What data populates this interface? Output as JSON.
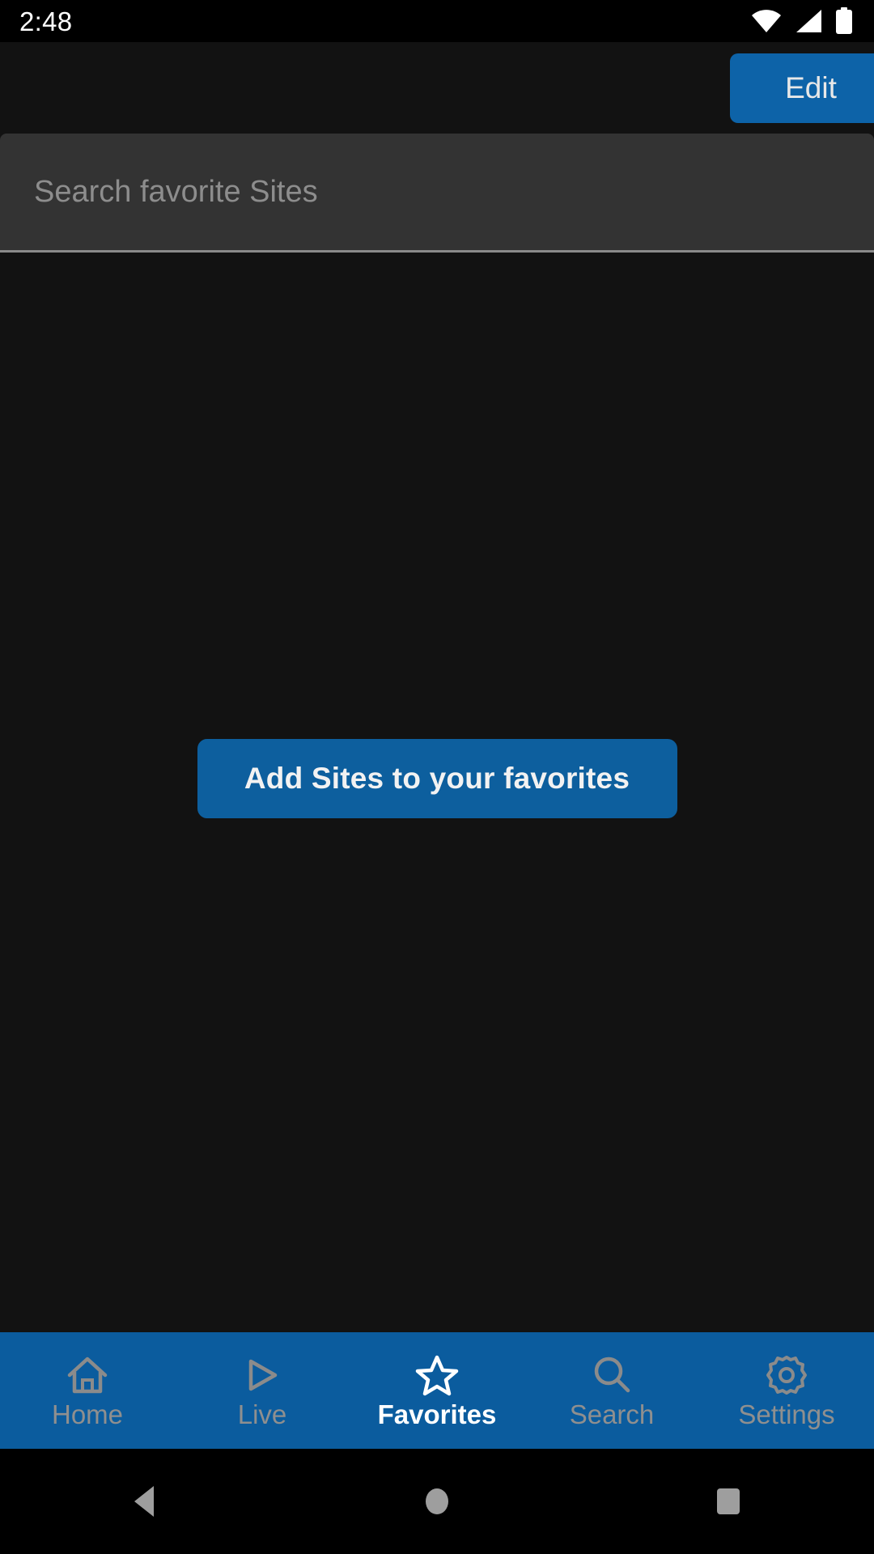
{
  "status_bar": {
    "clock": "2:48",
    "icons": [
      "wifi-icon",
      "cellular-signal-icon",
      "battery-icon"
    ]
  },
  "toolbar": {
    "edit_label": "Edit"
  },
  "search": {
    "placeholder": "Search favorite Sites",
    "value": ""
  },
  "content": {
    "add_favorites_label": "Add Sites to your favorites"
  },
  "bottom_nav": {
    "items": [
      {
        "label": "Home",
        "icon": "home-icon",
        "active": false
      },
      {
        "label": "Live",
        "icon": "play-icon",
        "active": false
      },
      {
        "label": "Favorites",
        "icon": "star-icon",
        "active": true
      },
      {
        "label": "Search",
        "icon": "search-icon",
        "active": false
      },
      {
        "label": "Settings",
        "icon": "gear-icon",
        "active": false
      }
    ]
  },
  "system_nav": {
    "back_label": "Back",
    "home_label": "Home",
    "recents_label": "Recent apps"
  },
  "colors": {
    "accent_blue": "#0b5c9e",
    "button_blue": "#0d5f9e",
    "edit_blue": "#0d63a8",
    "background": "#121212",
    "search_field": "#333333",
    "status_bar": "#000000",
    "inactive_nav": "#8f8f8f",
    "active_nav": "#ffffff"
  }
}
